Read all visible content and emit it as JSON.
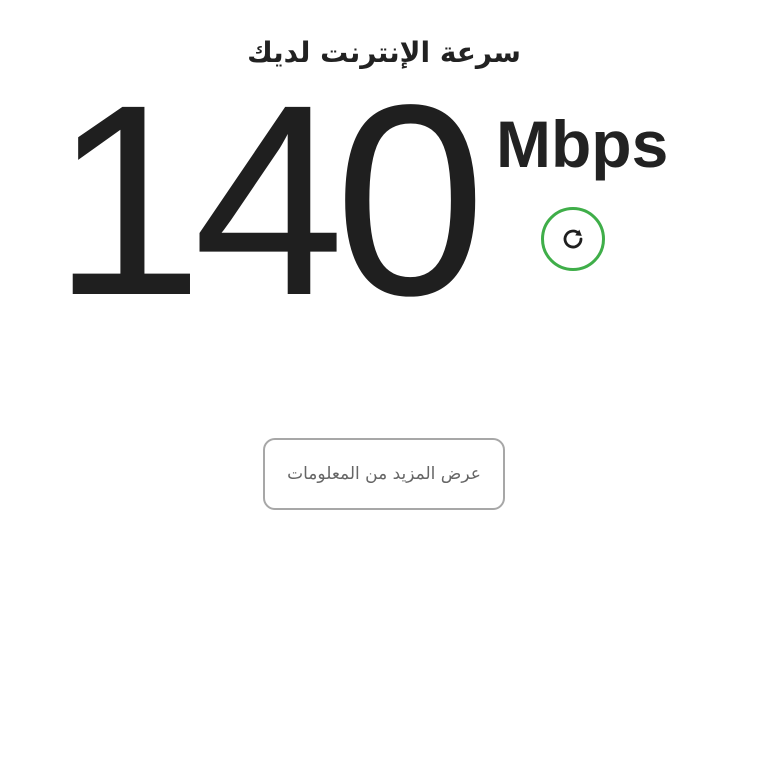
{
  "header": {
    "title": "سرعة الإنترنت لديك"
  },
  "speed": {
    "value": "140",
    "unit": "Mbps"
  },
  "refresh": {
    "icon": "refresh-icon",
    "accent_color": "#3fae49"
  },
  "actions": {
    "more_info_label": "عرض المزيد من المعلومات"
  }
}
